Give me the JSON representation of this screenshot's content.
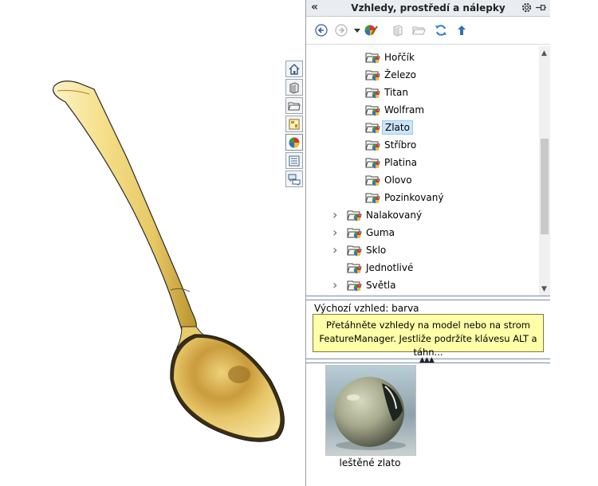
{
  "panel": {
    "title": "Vzhledy, prostředí a nálepky",
    "collapse_glyph": "«"
  },
  "toolbar": {
    "icons": [
      "back-icon",
      "forward-icon",
      "dropdown-arrow-icon",
      "edit-appearance-icon",
      "copy-appearance-icon",
      "open-folder-icon",
      "refresh-icon",
      "up-folder-icon"
    ]
  },
  "tree": {
    "items": [
      {
        "label": "Hořčík",
        "indent": 2,
        "expandable": false,
        "selected": false
      },
      {
        "label": "Železo",
        "indent": 2,
        "expandable": false,
        "selected": false
      },
      {
        "label": "Titan",
        "indent": 2,
        "expandable": false,
        "selected": false
      },
      {
        "label": "Wolfram",
        "indent": 2,
        "expandable": false,
        "selected": false
      },
      {
        "label": "Zlato",
        "indent": 2,
        "expandable": false,
        "selected": true
      },
      {
        "label": "Stříbro",
        "indent": 2,
        "expandable": false,
        "selected": false
      },
      {
        "label": "Platina",
        "indent": 2,
        "expandable": false,
        "selected": false
      },
      {
        "label": "Olovo",
        "indent": 2,
        "expandable": false,
        "selected": false
      },
      {
        "label": "Pozinkovaný",
        "indent": 2,
        "expandable": false,
        "selected": false
      },
      {
        "label": "Nalakovaný",
        "indent": 1,
        "expandable": true,
        "selected": false
      },
      {
        "label": "Guma",
        "indent": 1,
        "expandable": true,
        "selected": false
      },
      {
        "label": "Sklo",
        "indent": 1,
        "expandable": true,
        "selected": false
      },
      {
        "label": "Jednotlivé",
        "indent": 1,
        "expandable": false,
        "selected": false
      },
      {
        "label": "Světla",
        "indent": 1,
        "expandable": true,
        "selected": false
      }
    ]
  },
  "default_appearance": "Výchozí vzhled: barva",
  "hint": {
    "line1": "Přetáhněte vzhledy na model nebo na strom",
    "line2": "FeatureManager. Jestliže podržíte klávesu ALT a táhn..."
  },
  "preview": {
    "label": "leštěné zlato"
  },
  "side_tabs": [
    "home-icon",
    "parts-library-icon",
    "file-explorer-icon",
    "view-palette-icon",
    "appearances-icon",
    "custom-properties-icon",
    "forum-icon"
  ],
  "colors": {
    "gold_light": "#f7e7a0",
    "gold_dark": "#b8902c",
    "selection": "#cce4f7",
    "tooltip_bg": "#ffffa8"
  }
}
